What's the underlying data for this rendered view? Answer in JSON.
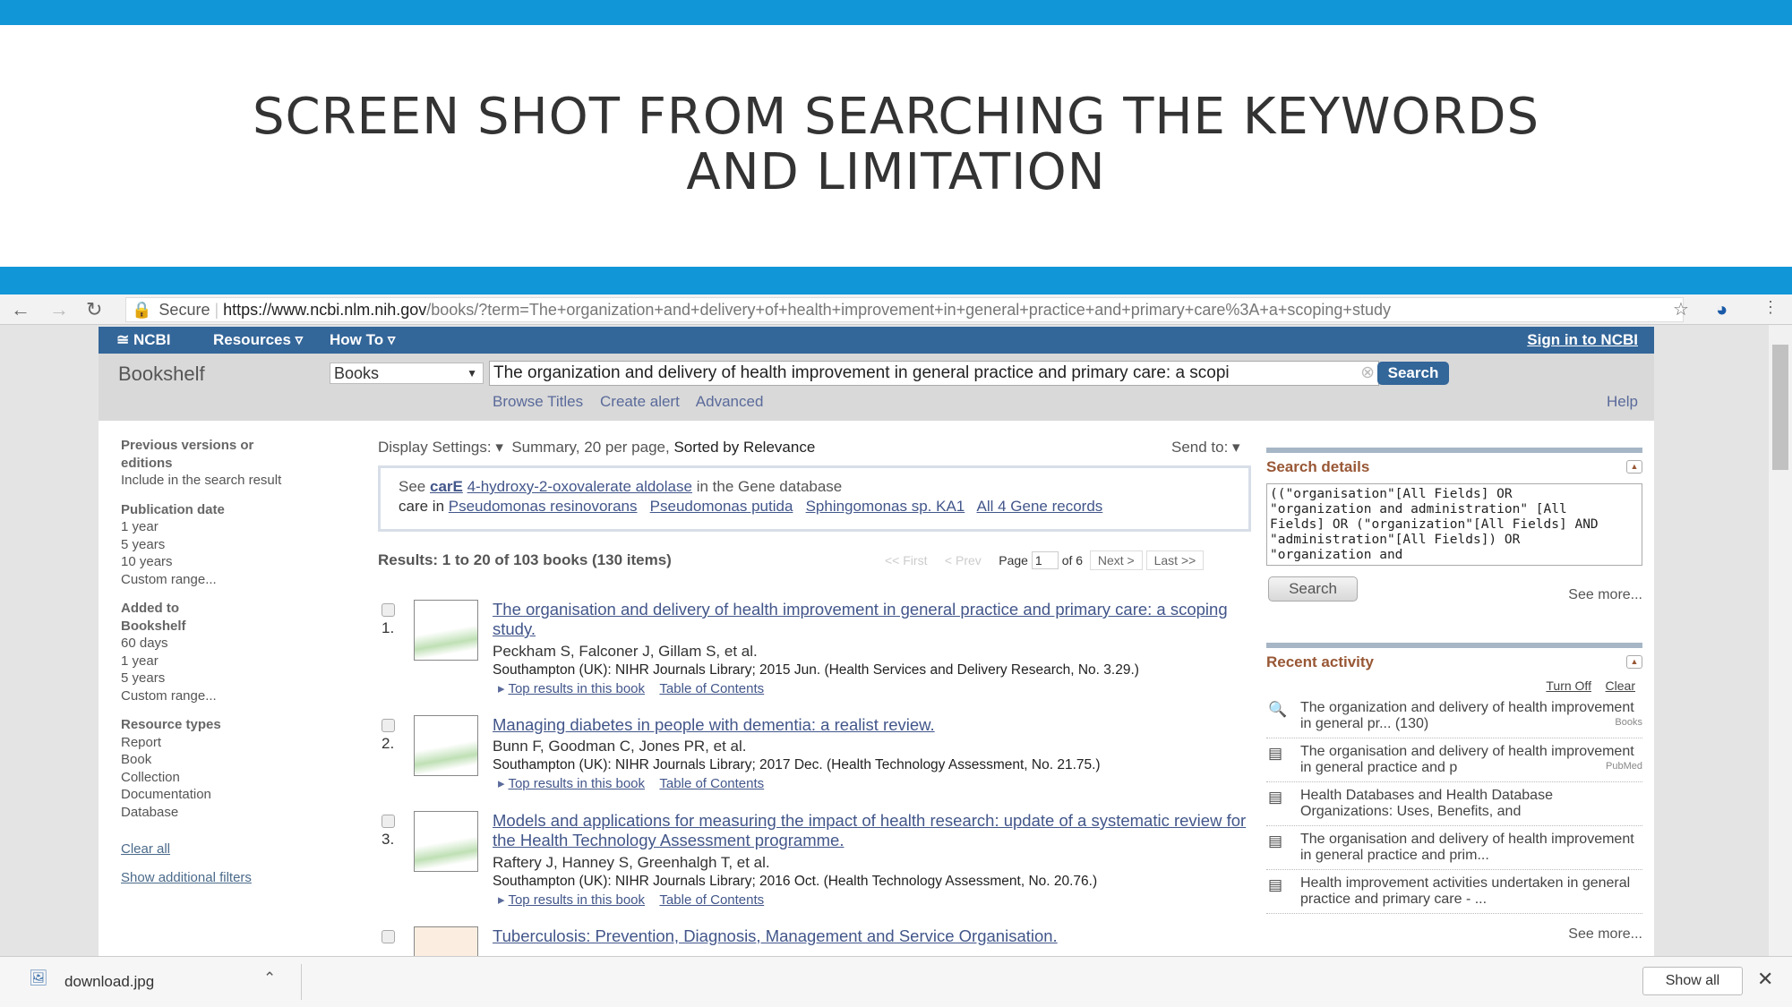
{
  "slide": {
    "title_line1": "SCREEN SHOT FROM SEARCHING THE KEYWORDS",
    "title_line2": "AND LIMITATION"
  },
  "browser": {
    "secure": "Secure",
    "url_domain": "https://www.ncbi.nlm.nih.gov",
    "url_path": "/books/?term=The+organization+and+delivery+of+health+improvement+in+general+practice+and+primary+care%3A+a+scoping+study"
  },
  "ncbi": {
    "logo": "NCBI",
    "resources": "Resources",
    "howto": "How To",
    "signin": "Sign in to NCBI"
  },
  "search": {
    "db_label": "Bookshelf",
    "db_select": "Books",
    "query": "The organization and delivery of health improvement in general practice and primary care: a scopi",
    "button": "Search",
    "links": [
      "Browse Titles",
      "Create alert",
      "Advanced"
    ],
    "help": "Help"
  },
  "sidebar": {
    "groups": [
      {
        "title": "Previous versions or editions",
        "items": [
          "Include in the search result"
        ]
      },
      {
        "title": "Publication date",
        "items": [
          "1 year",
          "5 years",
          "10 years",
          "Custom range..."
        ]
      },
      {
        "title": "Added to Bookshelf",
        "items": [
          "60 days",
          "1 year",
          "5 years",
          "Custom range..."
        ]
      },
      {
        "title": "Resource types",
        "items": [
          "Report",
          "Book",
          "Collection",
          "Documentation",
          "Database"
        ]
      }
    ],
    "clear_all": "Clear all",
    "show_more": "Show additional filters"
  },
  "results": {
    "display_settings": "Display Settings:",
    "summary": "Summary, 20 per page,",
    "sorted": "Sorted by Relevance",
    "send_to": "Send to:",
    "gene": {
      "see": "See",
      "gene": "carE",
      "name": "4-hydroxy-2-oxovalerate aldolase",
      "tail": "in the Gene database",
      "care_in": "care in",
      "orgs": [
        "Pseudomonas resinovorans",
        "Pseudomonas putida",
        "Sphingomonas sp. KA1",
        "All 4 Gene records"
      ]
    },
    "count": "Results: 1 to 20 of 103 books (130 items)",
    "pager": {
      "first": "<< First",
      "prev": "< Prev",
      "page": "Page",
      "current": "1",
      "of": "of 6",
      "next": "Next >",
      "last": "Last >>"
    },
    "items": [
      {
        "n": "1.",
        "title": "The organisation and delivery of health improvement in general practice and primary care: a scoping study.",
        "authors": "Peckham S, Falconer J, Gillam S, et al.",
        "source": "Southampton (UK): NIHR Journals Library; 2015 Jun. (Health Services and Delivery Research, No. 3.29.)",
        "l1": "Top results in this book",
        "l2": "Table of Contents"
      },
      {
        "n": "2.",
        "title": "Managing diabetes in people with dementia: a realist review.",
        "authors": "Bunn F, Goodman C, Jones PR, et al.",
        "source": "Southampton (UK): NIHR Journals Library; 2017 Dec. (Health Technology Assessment, No. 21.75.)",
        "l1": "Top results in this book",
        "l2": "Table of Contents"
      },
      {
        "n": "3.",
        "title": "Models and applications for measuring the impact of health research: update of a systematic review for the Health Technology Assessment programme.",
        "authors": "Raftery J, Hanney S, Greenhalgh T, et al.",
        "source": "Southampton (UK): NIHR Journals Library; 2016 Oct. (Health Technology Assessment, No. 20.76.)",
        "l1": "Top results in this book",
        "l2": "Table of Contents"
      },
      {
        "n": "4.",
        "title": "Tuberculosis: Prevention, Diagnosis, Management and Service Organisation."
      }
    ]
  },
  "details": {
    "title": "Search details",
    "query": "((\"organisation\"[All Fields] OR \"organization and administration\" [All Fields] OR (\"organization\"[All Fields] AND \"administration\"[All Fields]) OR \"organization and",
    "button": "Search",
    "see_more": "See more..."
  },
  "recent": {
    "title": "Recent activity",
    "turn_off": "Turn Off",
    "clear": "Clear",
    "see_more": "See more...",
    "items": [
      {
        "icon": "search-icon",
        "text": "The organization and delivery of health improvement in general pr... (130)",
        "db": "Books"
      },
      {
        "icon": "document-icon",
        "text": "The organisation and delivery of health improvement in general practice and p",
        "db": "PubMed"
      },
      {
        "icon": "document-icon",
        "text": "Health Databases and Health Database Organizations: Uses, Benefits, and",
        "db": ""
      },
      {
        "icon": "document-icon",
        "text": "The organisation and delivery of health improvement in general practice and prim...",
        "db": ""
      },
      {
        "icon": "document-icon",
        "text": "Health improvement activities undertaken in general practice and primary care - ...",
        "db": ""
      }
    ]
  },
  "download": {
    "file": "download.jpg",
    "show_all": "Show all"
  },
  "colors": {
    "slide_blue": "#1196d8",
    "ncbi_blue": "#336699",
    "link": "#42568a",
    "panel_heading": "#985735"
  }
}
